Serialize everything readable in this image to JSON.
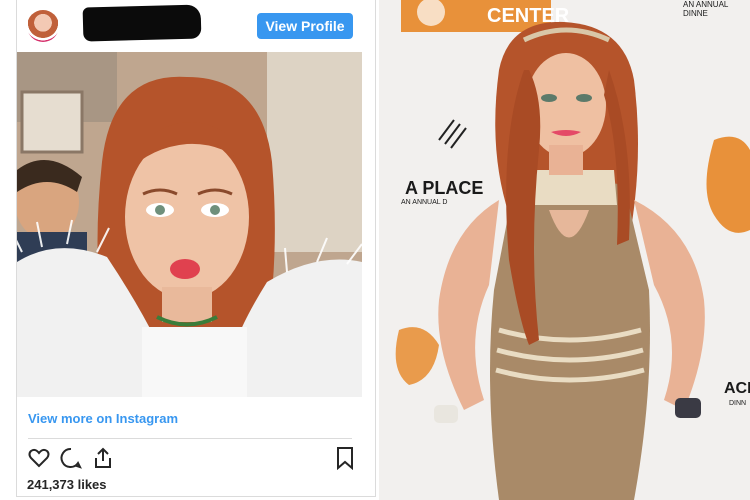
{
  "instagram": {
    "view_profile_label": "View Profile",
    "view_more_label": "View more on Instagram",
    "likes": "241,373 likes"
  },
  "event_backdrop": {
    "center_text": "CENTER",
    "a_place_text": "A PLACE",
    "annual_text": "AN ANNUAL D",
    "corner_text": "AN ANNUAL DINNE",
    "side_text": "ACE",
    "tiny_text": "DINN"
  },
  "colors": {
    "instagram_blue": "#3897f0",
    "backdrop_orange": "#e8913a",
    "hair": "#b5542b"
  },
  "icons": [
    "heart-icon",
    "comment-icon",
    "share-icon",
    "bookmark-icon"
  ]
}
